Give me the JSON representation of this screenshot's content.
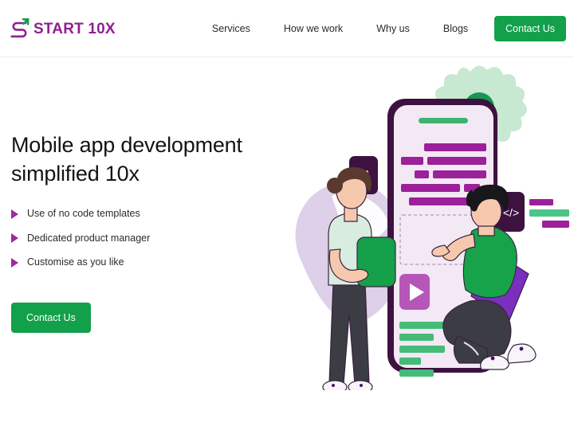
{
  "brand": {
    "name": "START 10X",
    "mark_icon": "s-arrow-logo-icon",
    "purple": "#8f2191",
    "green": "#12a04a"
  },
  "header": {
    "nav": [
      {
        "label": "Services"
      },
      {
        "label": "How we work"
      },
      {
        "label": "Why us"
      },
      {
        "label": "Blogs"
      }
    ],
    "cta_label": "Contact Us"
  },
  "hero": {
    "title": "Mobile app development simplified 10x",
    "bullets": [
      {
        "label": "Use of no code templates"
      },
      {
        "label": "Dedicated product manager"
      },
      {
        "label": "Customise as you like"
      }
    ],
    "cta_label": "Contact Us"
  },
  "illustration": {
    "name": "app-development-illustration",
    "phone_mockup": {
      "name": "phone-mockup",
      "frame_color": "#3d1140",
      "screen_color": "#f3e9f5",
      "header_bar_color": "#3cb371",
      "purple_code_color": "#9c2099",
      "green_code_color": "#44bb77",
      "placeholder_box": "dashed-image-placeholder",
      "play_button": "play-button-icon",
      "terminal_prompt": "terminal-prompt-icon"
    },
    "badges": [
      {
        "name": "curly-braces-badge",
        "glyph": "{ }"
      },
      {
        "name": "code-tag-badge",
        "glyph": "</>"
      }
    ],
    "decorations": [
      {
        "name": "gear-icon",
        "color": "#c7e8d1"
      },
      {
        "name": "sparkle-icon",
        "color": "#f5c518"
      },
      {
        "name": "background-blob",
        "color": "#ddd0e8"
      }
    ],
    "figures": [
      {
        "name": "woman-holding-panel",
        "shirt": "#d9ece0",
        "panel": "#15a04a"
      },
      {
        "name": "man-kneeling-pointing",
        "shirt": "#16a34a",
        "panel": "#7a2fbe"
      }
    ]
  }
}
